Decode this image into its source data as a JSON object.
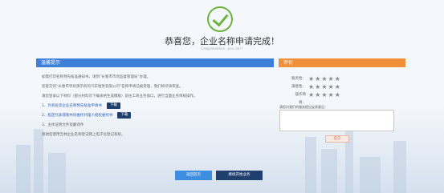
{
  "header": {
    "title": "恭喜您，企业名称申请完成！",
    "subtitle": "Congratulation , you can !"
  },
  "tips": {
    "heading": "温馨提示",
    "lines": [
      "如需打印名称预先核准通知书，请到“长春市市场监督管理局”办理。",
      "您提交的“长春市手续演示的的汽车租赁有限公司”名称申请已被受理，我们将尽快审查。",
      "请您登录以下材料（部分材料可下载表格生成模板）前往工商业务窗口，进行当面业务审核操作。",
      "1、外商投资企业名称预先核准申请书",
      "2、指定代表或者共同委托代理人授权委托书",
      "3、主体证明文件及翻译件",
      "感谢您使用吉林企业名称登记网上电子化登记系统。"
    ],
    "download_label": "下载"
  },
  "rating": {
    "heading": "评价",
    "rows": [
      {
        "label": "服务性：",
        "stars": "★★★★★"
      },
      {
        "label": "满意性：",
        "stars": "★★★★★"
      },
      {
        "label": "操作简易：",
        "stars": "★★★★★"
      }
    ],
    "comment_label": "请您对我们的服务提出宝贵意见：",
    "comment_value": "",
    "submit_label": "提交"
  },
  "actions": {
    "home_label": "返回首页",
    "continue_label": "继续开始业务"
  }
}
